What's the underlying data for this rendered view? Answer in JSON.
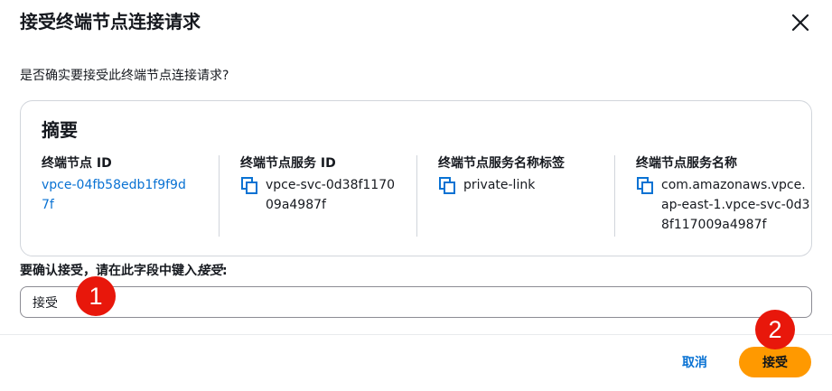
{
  "dialog": {
    "title": "接受终端节点连接请求",
    "question": "是否确实要接受此终端节点连接请求?"
  },
  "summary": {
    "title": "摘要",
    "fields": [
      {
        "label": "终端节点 ID",
        "value": "vpce-04fb58edb1f9f9d7f"
      },
      {
        "label": "终端节点服务 ID",
        "value": "vpce-svc-0d38f117009a4987f"
      },
      {
        "label": "终端节点服务名称标签",
        "value": "private-link"
      },
      {
        "label": "终端节点服务名称",
        "value": "com.amazonaws.vpce.ap-east-1.vpce-svc-0d38f117009a4987f"
      }
    ]
  },
  "confirm": {
    "label_prefix": "要确认接受，请在此字段中键入",
    "label_keyword": "接受",
    "label_suffix": ":",
    "input_value": "接受"
  },
  "footer": {
    "cancel_label": "取消",
    "accept_label": "接受"
  },
  "annotations": [
    {
      "number": "1"
    },
    {
      "number": "2"
    }
  ],
  "colors": {
    "link": "#0972d3",
    "primary_button": "#ff9900",
    "annotation_badge": "#e8170b"
  },
  "icons": {
    "close": "close-icon",
    "copy": "copy-icon"
  }
}
